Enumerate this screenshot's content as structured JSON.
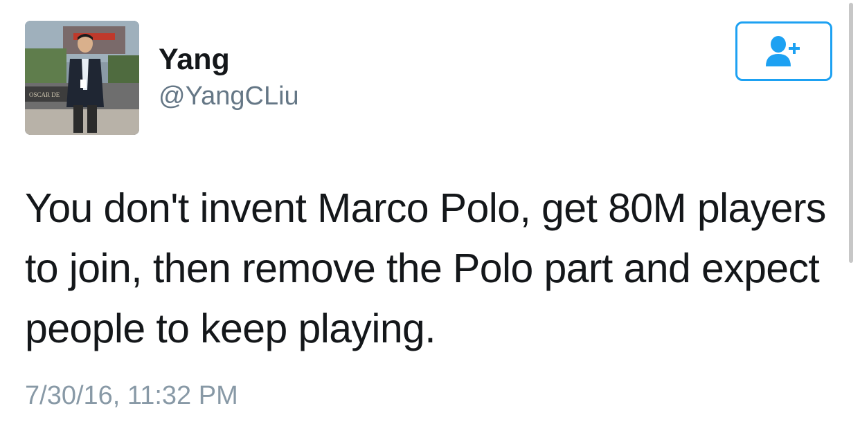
{
  "user": {
    "display_name": "Yang",
    "handle": "@YangCLiu",
    "avatar_alt": "profile-photo"
  },
  "follow_button": {
    "icon": "person-add-icon",
    "color": "#1da1f2"
  },
  "tweet": {
    "text": "You don't invent Marco Polo, get 80M players to join, then remove the Polo part and expect people to keep playing.",
    "timestamp": "7/30/16, 11:32 PM"
  },
  "avatar_sign_text": "OSCAR DE"
}
